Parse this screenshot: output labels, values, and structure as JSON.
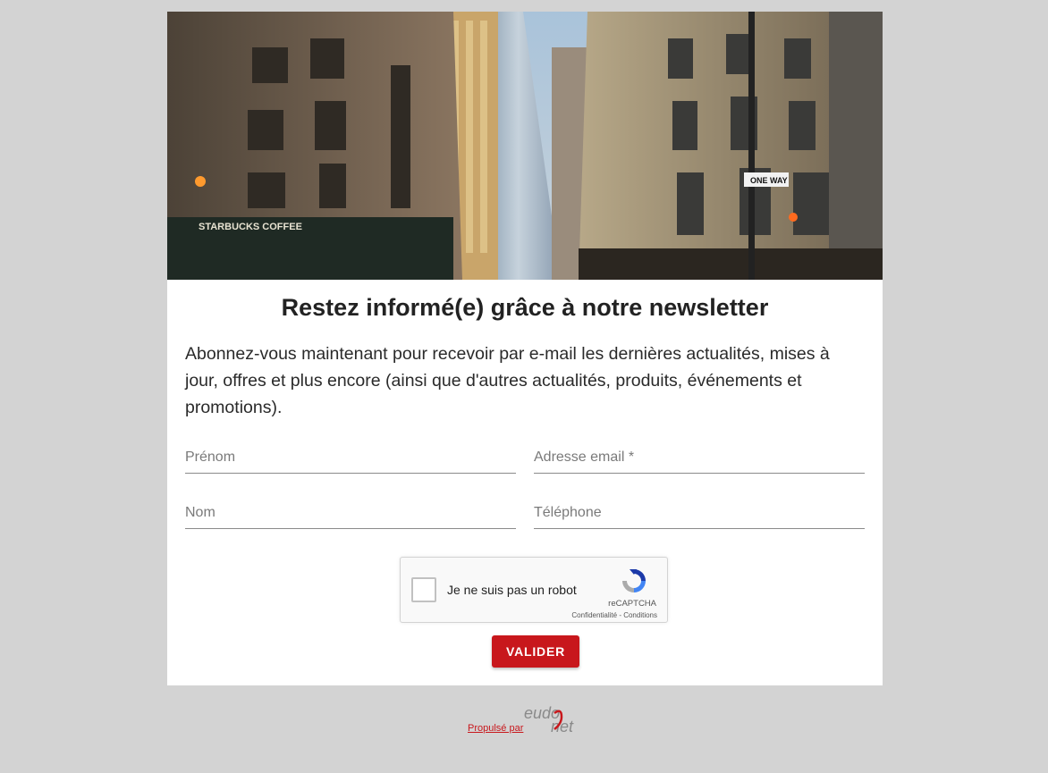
{
  "hero": {
    "sign_starbucks": "STARBUCKS COFFEE",
    "sign_oneway": "ONE WAY"
  },
  "form": {
    "title": "Restez informé(e) grâce à notre newsletter",
    "description": "Abonnez-vous maintenant pour recevoir par e-mail les dernières actualités, mises à jour, offres et plus encore (ainsi que d'autres actualités, produits, événements et promotions).",
    "fields": {
      "firstname_placeholder": "Prénom",
      "email_placeholder": "Adresse email *",
      "lastname_placeholder": "Nom",
      "phone_placeholder": "Téléphone"
    },
    "captcha": {
      "label": "Je ne suis pas un robot",
      "brand": "reCAPTCHA",
      "links": "Confidentialité - Conditions"
    },
    "submit_label": "VALIDER"
  },
  "footer": {
    "powered_by": "Propulsé par",
    "logo_text_top": "eudo",
    "logo_text_bottom": "net"
  },
  "colors": {
    "accent": "#c8171c",
    "page_background": "#d3d3d3",
    "card_background": "#ffffff"
  }
}
